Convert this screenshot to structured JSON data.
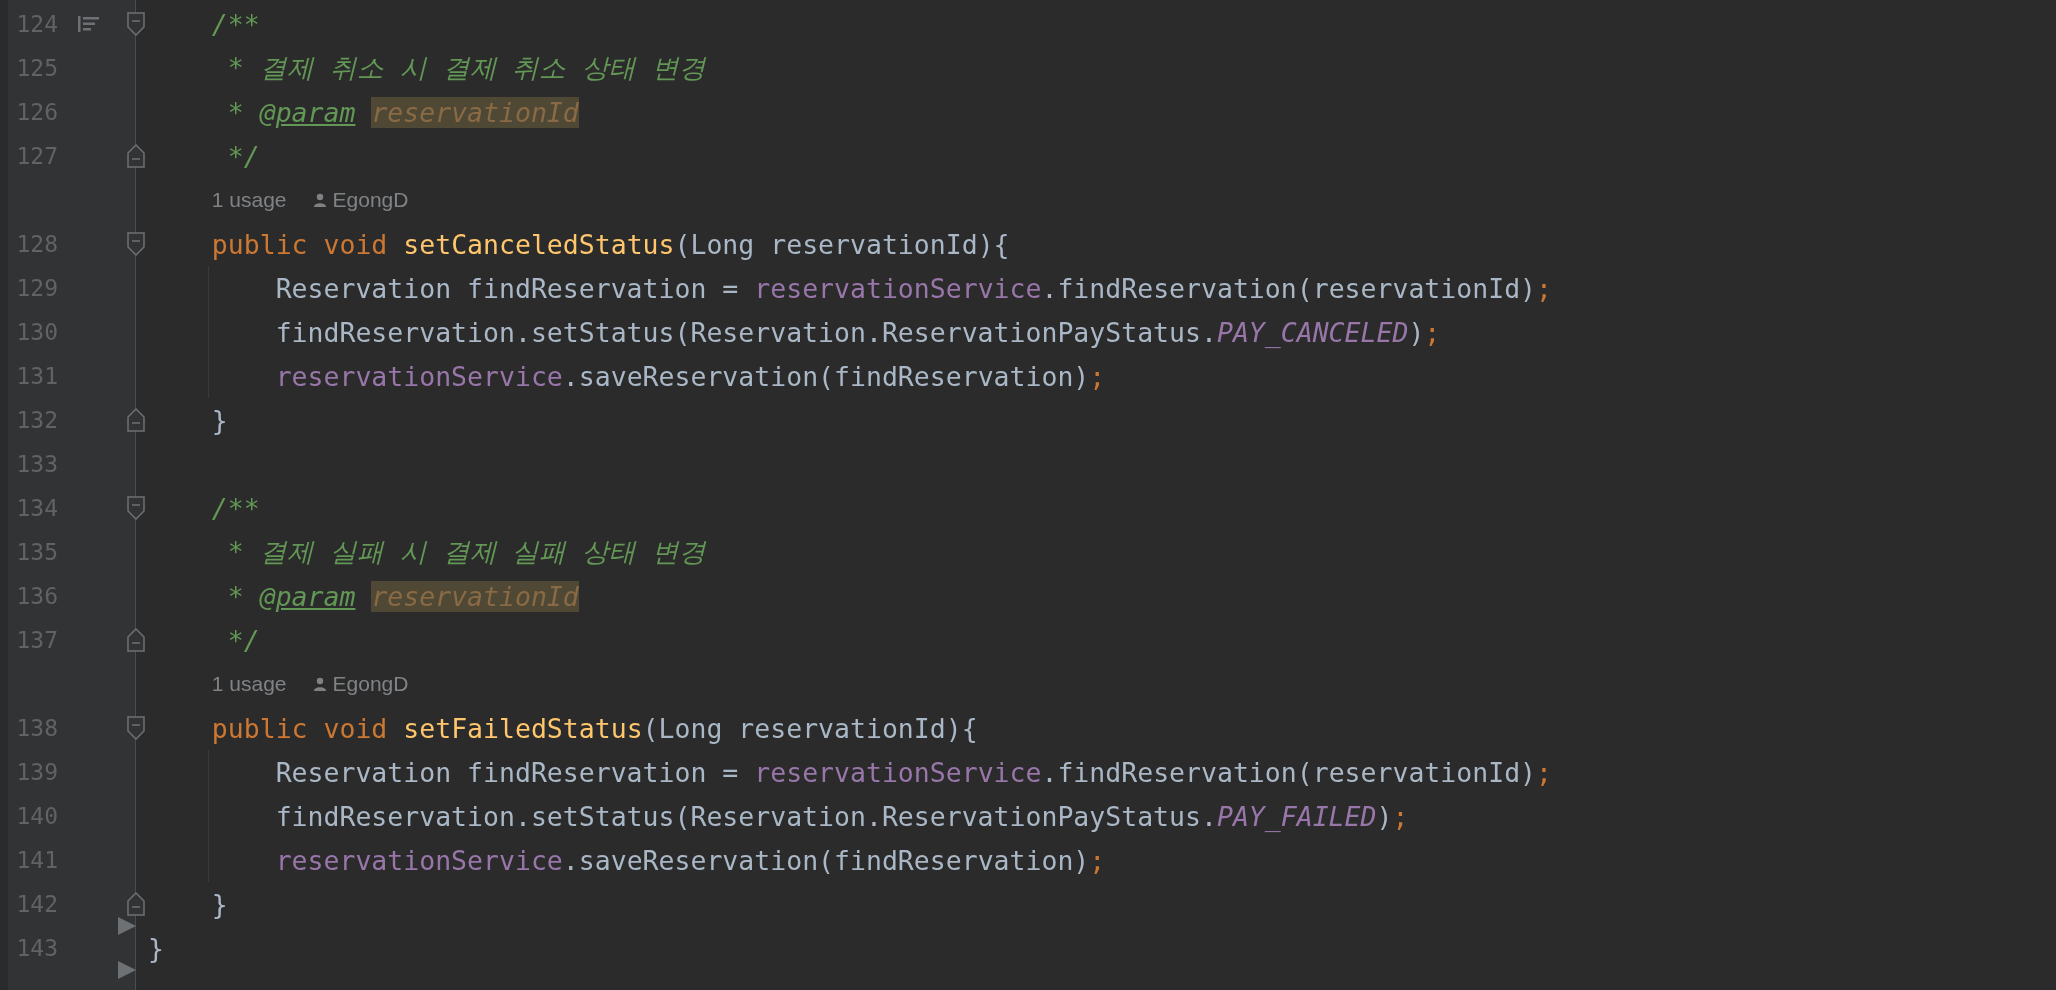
{
  "lines": [
    {
      "kind": "code",
      "number": "124",
      "fold_open": true,
      "structure_icon": true,
      "tokens": [
        {
          "kind": "comment",
          "text": "    /**"
        }
      ]
    },
    {
      "kind": "code",
      "number": "125",
      "tokens": [
        {
          "kind": "comment",
          "text": "     * 결제 취소 시 결제 취소 상태 변경"
        }
      ]
    },
    {
      "kind": "code",
      "number": "126",
      "tokens": [
        {
          "kind": "comment",
          "text": "     * "
        },
        {
          "kind": "doctag",
          "text": "@param"
        },
        {
          "kind": "param",
          "text": "reservationId"
        }
      ]
    },
    {
      "kind": "code",
      "number": "127",
      "fold_close": true,
      "tokens": [
        {
          "kind": "comment",
          "text": "     */"
        }
      ]
    },
    {
      "kind": "hint",
      "usages": "1 usage",
      "author": "EgongD"
    },
    {
      "kind": "code",
      "number": "128",
      "fold_open": true,
      "tokens": [
        {
          "kind": "keyword",
          "text": "    public void "
        },
        {
          "kind": "method",
          "text": "setCanceledStatus"
        },
        {
          "kind": "plain",
          "text": "(Long reservationId){"
        }
      ]
    },
    {
      "kind": "code",
      "number": "129",
      "tokens": [
        {
          "kind": "plain",
          "text": "        Reservation findReservation = "
        },
        {
          "kind": "field",
          "text": "reservationService"
        },
        {
          "kind": "plain",
          "text": ".findReservation(reservationId)"
        },
        {
          "kind": "punct",
          "text": ";"
        }
      ]
    },
    {
      "kind": "code",
      "number": "130",
      "tokens": [
        {
          "kind": "plain",
          "text": "        findReservation.setStatus(Reservation.ReservationPayStatus."
        },
        {
          "kind": "constant",
          "text": "PAY_CANCELED"
        },
        {
          "kind": "plain",
          "text": ")"
        },
        {
          "kind": "punct",
          "text": ";"
        }
      ]
    },
    {
      "kind": "code",
      "number": "131",
      "tokens": [
        {
          "kind": "field",
          "text": "        reservationService"
        },
        {
          "kind": "plain",
          "text": ".saveReservation(findReservation)"
        },
        {
          "kind": "punct",
          "text": ";"
        }
      ]
    },
    {
      "kind": "code",
      "number": "132",
      "fold_close": true,
      "tokens": [
        {
          "kind": "plain",
          "text": "    }"
        }
      ]
    },
    {
      "kind": "code",
      "number": "133"
    },
    {
      "kind": "code",
      "number": "134",
      "fold_open": true,
      "tokens": [
        {
          "kind": "comment",
          "text": "    /**"
        }
      ]
    },
    {
      "kind": "code",
      "number": "135",
      "tokens": [
        {
          "kind": "comment",
          "text": "     * 결제 실패 시 결제 실패 상태 변경"
        }
      ]
    },
    {
      "kind": "code",
      "number": "136",
      "tokens": [
        {
          "kind": "comment",
          "text": "     * "
        },
        {
          "kind": "doctag",
          "text": "@param"
        },
        {
          "kind": "param",
          "text": "reservationId"
        }
      ]
    },
    {
      "kind": "code",
      "number": "137",
      "fold_close": true,
      "tokens": [
        {
          "kind": "comment",
          "text": "     */"
        }
      ]
    },
    {
      "kind": "hint",
      "usages": "1 usage",
      "author": "EgongD"
    },
    {
      "kind": "code",
      "number": "138",
      "fold_open": true,
      "tokens": [
        {
          "kind": "keyword",
          "text": "    public void "
        },
        {
          "kind": "method",
          "text": "setFailedStatus"
        },
        {
          "kind": "plain",
          "text": "(Long reservationId){"
        }
      ]
    },
    {
      "kind": "code",
      "number": "139",
      "tokens": [
        {
          "kind": "plain",
          "text": "        Reservation findReservation = "
        },
        {
          "kind": "field",
          "text": "reservationService"
        },
        {
          "kind": "plain",
          "text": ".findReservation(reservationId)"
        },
        {
          "kind": "punct",
          "text": ";"
        }
      ]
    },
    {
      "kind": "code",
      "number": "140",
      "tokens": [
        {
          "kind": "plain",
          "text": "        findReservation.setStatus(Reservation.ReservationPayStatus."
        },
        {
          "kind": "constant",
          "text": "PAY_FAILED"
        },
        {
          "kind": "plain",
          "text": ")"
        },
        {
          "kind": "punct",
          "text": ";"
        }
      ]
    },
    {
      "kind": "code",
      "number": "141",
      "tokens": [
        {
          "kind": "field",
          "text": "        reservationService"
        },
        {
          "kind": "plain",
          "text": ".saveReservation(findReservation)"
        },
        {
          "kind": "punct",
          "text": ";"
        }
      ]
    },
    {
      "kind": "code",
      "number": "142",
      "fold_close": true,
      "end_marker": true,
      "tokens": [
        {
          "kind": "plain",
          "text": "    }"
        }
      ]
    },
    {
      "kind": "code",
      "number": "143",
      "end_marker": true,
      "tokens": [
        {
          "kind": "plain",
          "text": "}"
        }
      ]
    }
  ]
}
